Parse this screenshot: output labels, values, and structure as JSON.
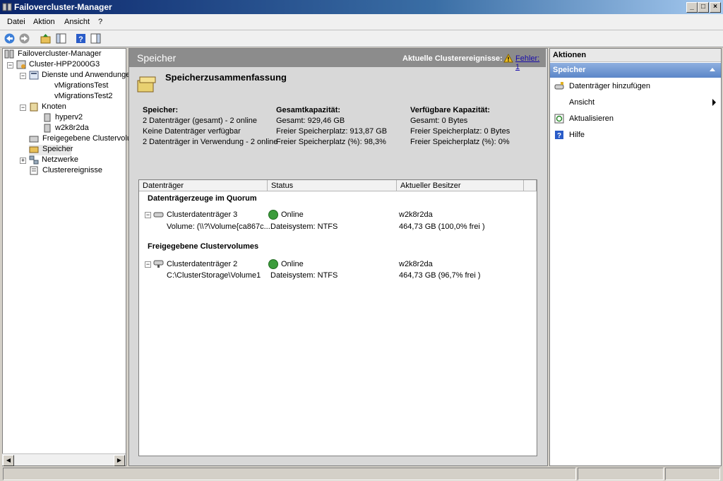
{
  "window": {
    "title": "Failovercluster-Manager"
  },
  "menu": [
    "Datei",
    "Aktion",
    "Ansicht",
    "?"
  ],
  "tree": {
    "root": "Failovercluster-Manager",
    "cluster": "Cluster-HPP2000G3",
    "services": "Dienste und Anwendungen",
    "vm1": "vMigrationsTest",
    "vm2": "vMigrationsTest2",
    "nodes": "Knoten",
    "node1": "hyperv2",
    "node2": "w2k8r2da",
    "csv": "Freigegebene Clustervolu",
    "storage": "Speicher",
    "networks": "Netzwerke",
    "events": "Clusterereignisse"
  },
  "header": {
    "title": "Speicher",
    "events_label": "Aktuelle Clusterereignisse:",
    "error_link": "Fehler: 1"
  },
  "summary": {
    "title": "Speicherzusammenfassung",
    "col1": {
      "heading": "Speicher:",
      "lines": [
        "2 Datenträger (gesamt) - 2 online",
        "Keine Datenträger verfügbar",
        "2 Datenträger in Verwendung - 2 online"
      ]
    },
    "col2": {
      "heading": "Gesamtkapazität:",
      "lines": [
        "Gesamt: 929,46 GB",
        "Freier Speicherplatz: 913,87 GB",
        "Freier Speicherplatz (%): 98,3%"
      ]
    },
    "col3": {
      "heading": "Verfügbare Kapazität:",
      "lines": [
        "Gesamt: 0 Bytes",
        "Freier Speicherplatz: 0 Bytes",
        "Freier Speicherplatz (%): 0%"
      ]
    }
  },
  "grid": {
    "columns": [
      "Datenträger",
      "Status",
      "Aktueller Besitzer"
    ],
    "groups": [
      {
        "name": "Datenträgerzeuge im Quorum",
        "disk": "Clusterdatenträger 3",
        "status": "Online",
        "owner": "w2k8r2da",
        "volume": "Volume: (\\\\?\\Volume{ca867c...",
        "fs": "Dateisystem: NTFS",
        "size": "464,73 GB (100,0% frei )"
      },
      {
        "name": "Freigegebene Clustervolumes",
        "disk": "Clusterdatenträger 2",
        "status": "Online",
        "owner": "w2k8r2da",
        "volume": "C:\\ClusterStorage\\Volume1",
        "fs": "Dateisystem: NTFS",
        "size": "464,73 GB (96,7% frei )"
      }
    ]
  },
  "actions": {
    "title": "Aktionen",
    "section": "Speicher",
    "items": [
      "Datenträger hinzufügen",
      "Ansicht",
      "Aktualisieren",
      "Hilfe"
    ]
  }
}
